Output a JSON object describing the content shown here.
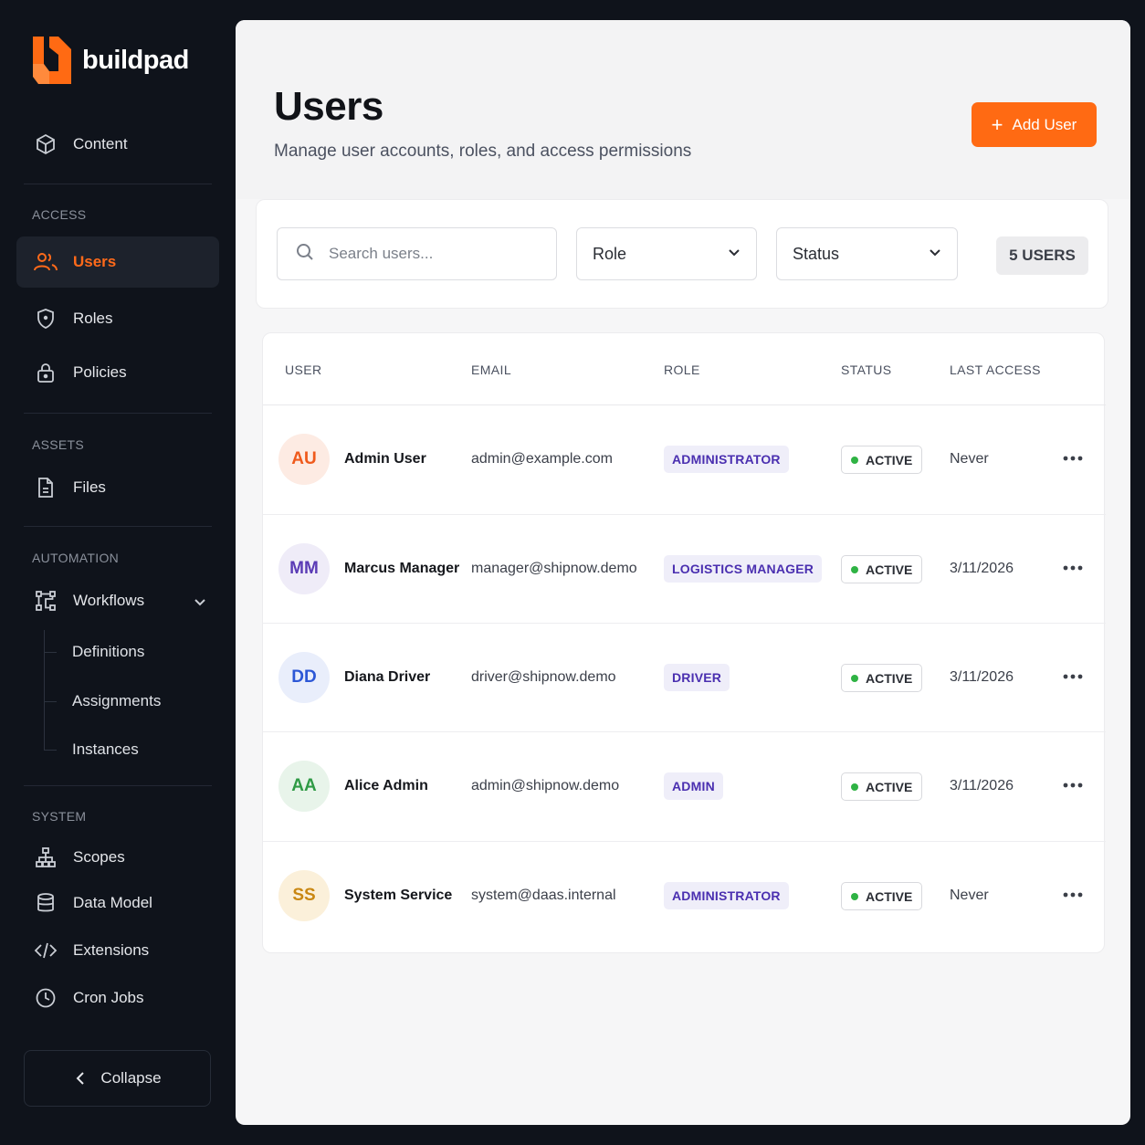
{
  "app": {
    "name": "buildpad",
    "brand_color": "#ff6a13"
  },
  "sidebar": {
    "top_item": {
      "label": "Content",
      "icon": "cube-icon"
    },
    "sections": {
      "access": {
        "label": "ACCESS",
        "items": [
          {
            "label": "Users",
            "icon": "users-icon",
            "active": true
          },
          {
            "label": "Roles",
            "icon": "shield-icon"
          },
          {
            "label": "Policies",
            "icon": "lock-icon"
          }
        ]
      },
      "assets": {
        "label": "ASSETS",
        "items": [
          {
            "label": "Files",
            "icon": "file-icon"
          }
        ]
      },
      "automation": {
        "label": "AUTOMATION",
        "items": [
          {
            "label": "Workflows",
            "icon": "workflow-icon",
            "expanded": true,
            "children": [
              "Definitions",
              "Assignments",
              "Instances"
            ]
          }
        ]
      },
      "system": {
        "label": "SYSTEM",
        "items": [
          {
            "label": "Scopes",
            "icon": "hierarchy-icon"
          },
          {
            "label": "Data Model",
            "icon": "database-icon"
          },
          {
            "label": "Extensions",
            "icon": "code-icon"
          },
          {
            "label": "Cron Jobs",
            "icon": "clock-icon"
          }
        ]
      }
    },
    "collapse_label": "Collapse"
  },
  "header": {
    "title": "Users",
    "subtitle": "Manage user accounts, roles, and access permissions",
    "add_button_label": "Add User"
  },
  "filters": {
    "search_placeholder": "Search users...",
    "role_label": "Role",
    "status_label": "Status",
    "count_label": "5 USERS"
  },
  "table": {
    "columns": [
      "USER",
      "EMAIL",
      "ROLE",
      "STATUS",
      "LAST ACCESS"
    ],
    "rows": [
      {
        "initials": "AU",
        "name": "Admin User",
        "email": "admin@example.com",
        "role": "ADMINISTRATOR",
        "status": "ACTIVE",
        "last_access": "Never",
        "avatar_bg": "#fdebe3",
        "avatar_fg": "#ef5a1c"
      },
      {
        "initials": "MM",
        "name": "Marcus Manager",
        "email": "manager@shipnow.demo",
        "role": "LOGISTICS MANAGER",
        "status": "ACTIVE",
        "last_access": "3/11/2026",
        "avatar_bg": "#efecf8",
        "avatar_fg": "#5a3bb5"
      },
      {
        "initials": "DD",
        "name": "Diana Driver",
        "email": "driver@shipnow.demo",
        "role": "DRIVER",
        "status": "ACTIVE",
        "last_access": "3/11/2026",
        "avatar_bg": "#e9eefb",
        "avatar_fg": "#2c57d6"
      },
      {
        "initials": "AA",
        "name": "Alice Admin",
        "email": "admin@shipnow.demo",
        "role": "ADMIN",
        "status": "ACTIVE",
        "last_access": "3/11/2026",
        "avatar_bg": "#e8f4ea",
        "avatar_fg": "#2f9a45"
      },
      {
        "initials": "SS",
        "name": "System Service",
        "email": "system@daas.internal",
        "role": "ADMINISTRATOR",
        "status": "ACTIVE",
        "last_access": "Never",
        "avatar_bg": "#fbf0da",
        "avatar_fg": "#c98712"
      }
    ]
  }
}
